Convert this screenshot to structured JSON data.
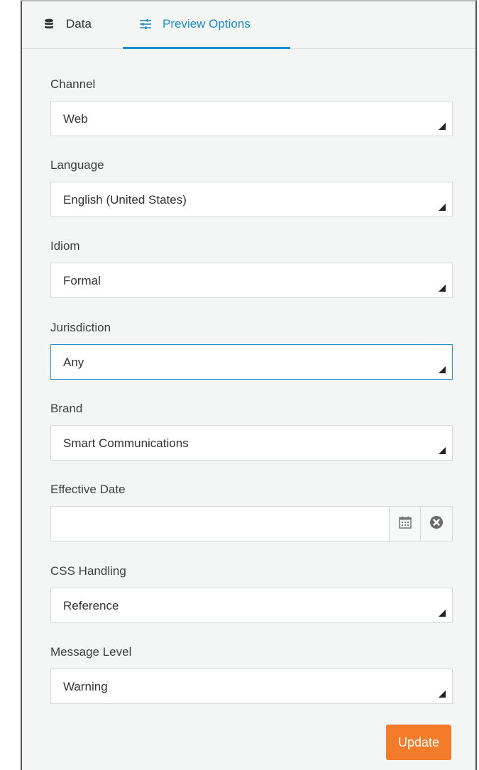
{
  "tabs": {
    "data_label": "Data",
    "preview_label": "Preview Options",
    "active": "Preview Options"
  },
  "fields": {
    "channel": {
      "label": "Channel",
      "value": "Web"
    },
    "language": {
      "label": "Language",
      "value": "English (United States)"
    },
    "idiom": {
      "label": "Idiom",
      "value": "Formal"
    },
    "jurisdiction": {
      "label": "Jurisdiction",
      "value": "Any"
    },
    "brand": {
      "label": "Brand",
      "value": "Smart Communications"
    },
    "effective_date": {
      "label": "Effective Date",
      "value": ""
    },
    "css_handling": {
      "label": "CSS Handling",
      "value": "Reference"
    },
    "message_level": {
      "label": "Message Level",
      "value": "Warning"
    }
  },
  "actions": {
    "update_label": "Update"
  },
  "icons": {
    "data": "database-icon",
    "preview": "sliders-icon",
    "calendar": "calendar-icon",
    "clear": "clear-circle-icon"
  },
  "colors": {
    "accent": "#1c8cc9",
    "button": "#f47b2a",
    "panel_bg": "#f4f6f6",
    "field_border": "#d7d9db",
    "focus_border": "#2a93cf"
  }
}
